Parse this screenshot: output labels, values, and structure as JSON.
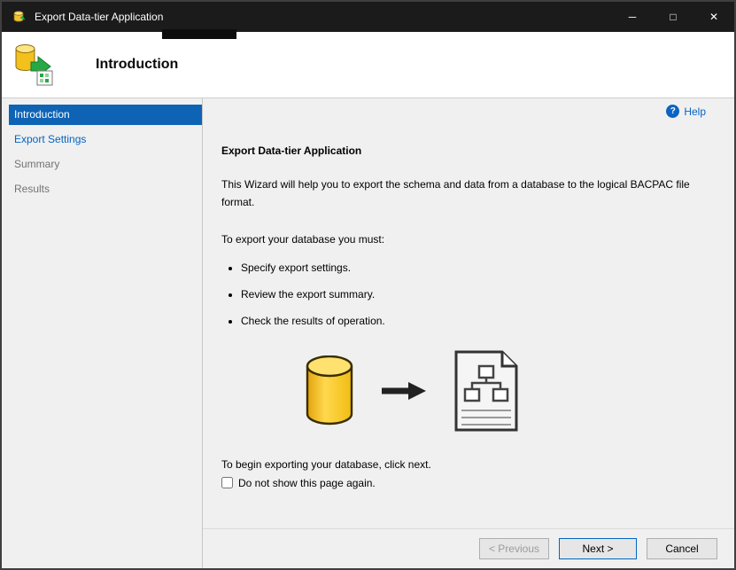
{
  "window": {
    "title": "Export Data-tier Application",
    "controls": {
      "minimize": "─",
      "maximize": "□",
      "close": "✕"
    }
  },
  "header": {
    "title": "Introduction"
  },
  "sidebar": {
    "items": [
      {
        "label": "Introduction",
        "state": "active"
      },
      {
        "label": "Export Settings",
        "state": "link"
      },
      {
        "label": "Summary",
        "state": "disabled"
      },
      {
        "label": "Results",
        "state": "disabled"
      }
    ]
  },
  "content": {
    "help_label": "Help",
    "help_glyph": "?",
    "heading": "Export Data-tier Application",
    "intro": "This Wizard will help you to export the schema and data from a database to the logical BACPAC file format.",
    "must_label": "To export your database you must:",
    "bullets": [
      "Specify export settings.",
      "Review the export summary.",
      "Check the results of operation."
    ],
    "begin_text": "To begin exporting your database, click next.",
    "checkbox_label": "Do not show this page again.",
    "checkbox_checked": false
  },
  "footer": {
    "previous_label": "< Previous",
    "next_label": "Next >",
    "cancel_label": "Cancel"
  },
  "colors": {
    "titlebar": "#1b1b1b",
    "accent": "#0e63b5",
    "link": "#0563c1",
    "next_border": "#0067c0",
    "database_yellow": "#f5c518"
  }
}
